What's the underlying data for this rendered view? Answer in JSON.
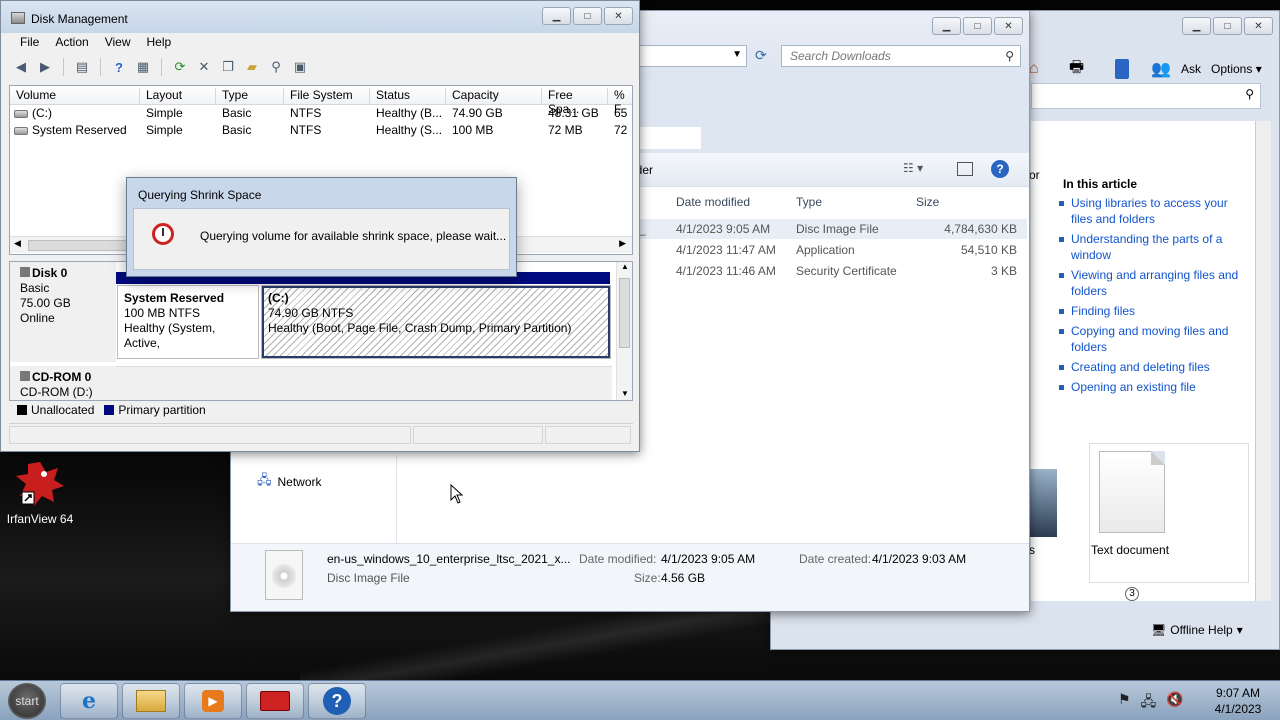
{
  "help": {
    "ask_label": "Ask",
    "options_label": "Options",
    "in_this_article": "In this article",
    "prefix_char": "or",
    "links": [
      "Using libraries to access your files and folders",
      "Understanding the parts of a window",
      "Viewing and arranging files and folders",
      "Finding files",
      "Copying and moving files and folders",
      "Creating and deleting files",
      "Opening an existing file"
    ],
    "thumb_label": "Text document",
    "thumb_label_partial": "s",
    "page_number": "3",
    "offline_help": "Offline Help"
  },
  "explorer": {
    "search_placeholder": "Search Downloads",
    "toolbar_partial": "lder",
    "columns": {
      "date_modified": "Date modified",
      "type": "Type",
      "size": "Size"
    },
    "files": [
      {
        "name_partial": "_",
        "date": "4/1/2023 9:05 AM",
        "type": "Disc Image File",
        "size": "4,784,630 KB"
      },
      {
        "name_partial": "",
        "date": "4/1/2023 11:47 AM",
        "type": "Application",
        "size": "54,510 KB"
      },
      {
        "name_partial": "",
        "date": "4/1/2023 11:46 AM",
        "type": "Security Certificate",
        "size": "3 KB"
      }
    ],
    "nav_network": "Network",
    "details": {
      "filename": "en-us_windows_10_enterprise_ltsc_2021_x...",
      "filetype": "Disc Image File",
      "date_modified_label": "Date modified:",
      "date_modified": "4/1/2023 9:05 AM",
      "size_label": "Size:",
      "size": "4.56 GB",
      "date_created_label": "Date created:",
      "date_created": "4/1/2023 9:03 AM"
    }
  },
  "disk_mgmt": {
    "title": "Disk Management",
    "menu": [
      "File",
      "Action",
      "View",
      "Help"
    ],
    "columns": [
      "Volume",
      "Layout",
      "Type",
      "File System",
      "Status",
      "Capacity",
      "Free Spa...",
      "% F"
    ],
    "volumes": [
      {
        "volume": "(C:)",
        "layout": "Simple",
        "type": "Basic",
        "fs": "NTFS",
        "status": "Healthy (B...",
        "capacity": "74.90 GB",
        "free": "48.31 GB",
        "pct": "65"
      },
      {
        "volume": "System Reserved",
        "layout": "Simple",
        "type": "Basic",
        "fs": "NTFS",
        "status": "Healthy (S...",
        "capacity": "100 MB",
        "free": "72 MB",
        "pct": "72"
      }
    ],
    "disk0": {
      "name": "Disk 0",
      "kind": "Basic",
      "size": "75.00 GB",
      "state": "Online",
      "sys_name": "System Reserved",
      "sys_size": "100 MB NTFS",
      "sys_status": "Healthy (System, Active,",
      "c_name": "(C:)",
      "c_size": "74.90 GB NTFS",
      "c_status": "Healthy (Boot, Page File, Crash Dump, Primary Partition)"
    },
    "cdrom": {
      "name": "CD-ROM 0",
      "drive": "CD-ROM (D:)"
    },
    "legend": {
      "unallocated": "Unallocated",
      "primary": "Primary partition"
    }
  },
  "dialog": {
    "title": "Querying Shrink Space",
    "message": "Querying volume for available shrink space, please wait..."
  },
  "desktop": {
    "icon_label": "IrfanView 64"
  },
  "taskbar": {
    "start_label": "start",
    "time": "9:07 AM",
    "date": "4/1/2023"
  },
  "colors": {
    "primary_partition": "#000a80",
    "link": "#1155cc"
  }
}
